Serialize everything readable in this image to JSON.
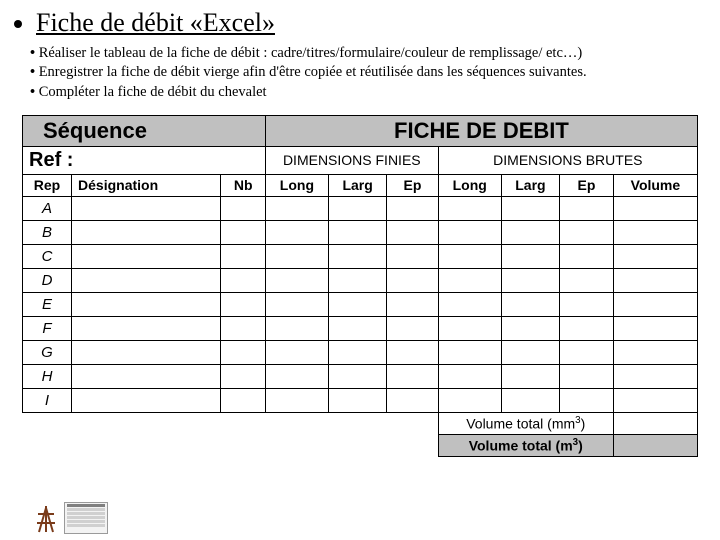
{
  "title": "Fiche de débit «Excel»",
  "bullets": [
    "Réaliser le tableau de la fiche de débit : cadre/titres/formulaire/couleur de remplissage/ etc…)",
    "Enregistrer la fiche de débit vierge afin d'être copiée et réutilisée dans les séquences suivantes.",
    "Compléter la fiche de débit du chevalet"
  ],
  "table": {
    "header1": {
      "sequence": "Séquence",
      "fiche": "FICHE DE DEBIT"
    },
    "header2": {
      "ref": "Ref :",
      "dim_fin": "DIMENSIONS FINIES",
      "dim_brut": "DIMENSIONS BRUTES"
    },
    "cols": [
      "Rep",
      "Désignation",
      "Nb",
      "Long",
      "Larg",
      "Ep",
      "Long",
      "Larg",
      "Ep",
      "Volume"
    ],
    "rows": [
      "A",
      "B",
      "C",
      "D",
      "E",
      "F",
      "G",
      "H",
      "I"
    ],
    "totals": {
      "mm3": "Volume total (mm",
      "mm3_sup": "3",
      "mm3_end": ")",
      "m3": "Volume total (m",
      "m3_sup": "3",
      "m3_end": ")"
    }
  }
}
